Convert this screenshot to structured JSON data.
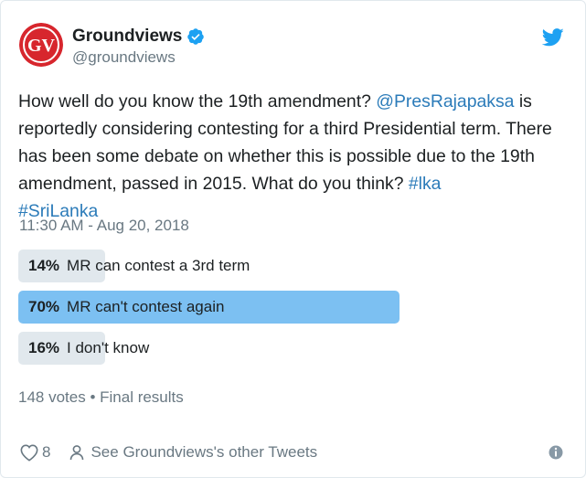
{
  "account": {
    "display_name": "Groundviews",
    "handle": "@groundviews",
    "logo_text": "GV",
    "logo_color": "#d7262d"
  },
  "tweet": {
    "text_plain_1": "How well do you know the 19th amendment? ",
    "mention": "@PresRajapaksa",
    "text_plain_2": " is reportedly considering contesting for a third Presidential term. There has been some debate on whether this is possible due to the 19th amendment, passed in 2015. What do you think? ",
    "hashtag_1": "#lka",
    "hashtag_2": "#SriLanka",
    "timestamp": "11:30 AM - Aug 20, 2018"
  },
  "poll": {
    "choices": [
      {
        "percent_label": "14%",
        "label": "MR can contest a 3rd term",
        "percent": 14,
        "winner": false
      },
      {
        "percent_label": "70%",
        "label": "MR can't contest again",
        "percent": 70,
        "winner": true
      },
      {
        "percent_label": "16%",
        "label": "I don't know",
        "percent": 16,
        "winner": false
      }
    ],
    "meta": "148 votes • Final results"
  },
  "footer": {
    "like_count": "8",
    "more_tweets_label": "See Groundviews's other Tweets"
  },
  "colors": {
    "link": "#2b7bb9",
    "muted": "#697882",
    "verified": "#1da1f2",
    "twitter_bird": "#1da1f2",
    "poll_winner": "#7cc0f2",
    "poll_other": "#e1e8ed"
  },
  "icons": {
    "verified": "verified-badge-icon",
    "bird": "twitter-bird-icon",
    "heart": "heart-icon",
    "person": "person-icon",
    "info": "info-icon"
  }
}
